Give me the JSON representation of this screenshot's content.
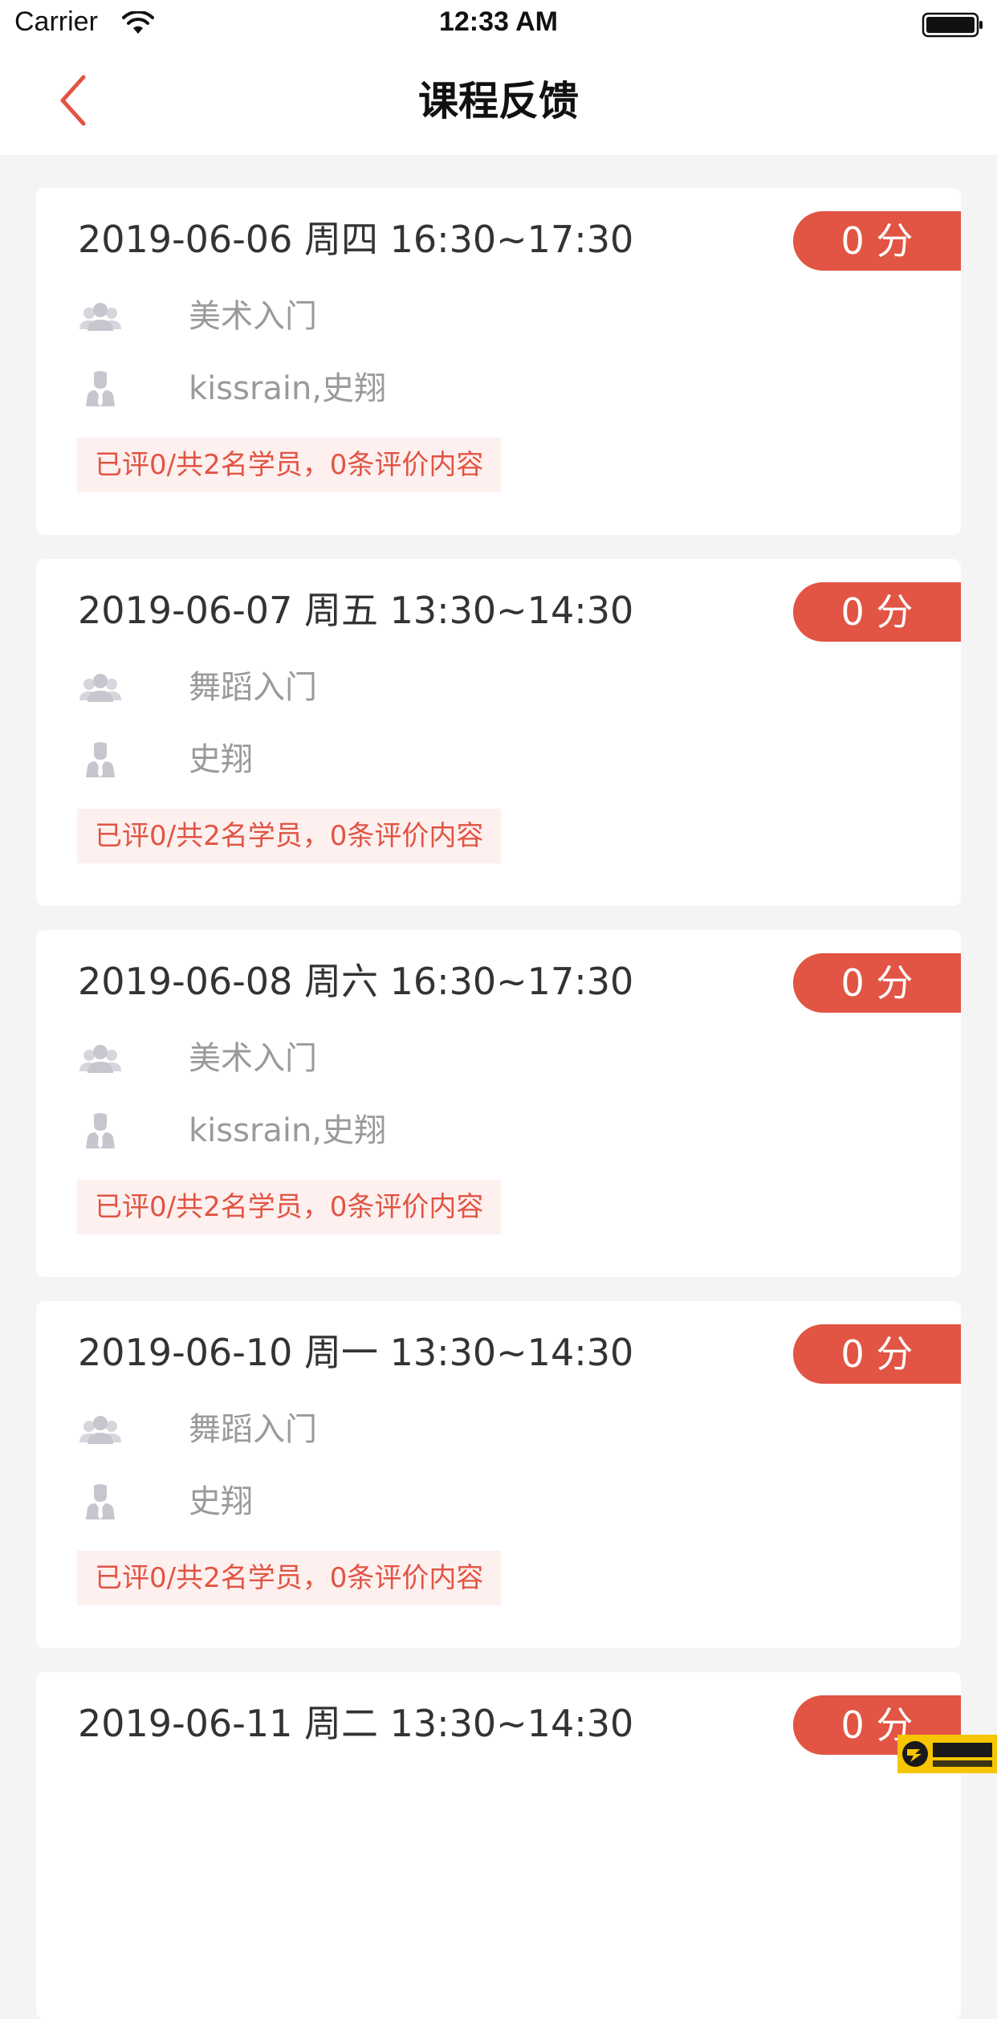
{
  "status_bar": {
    "carrier": "Carrier",
    "time": "12:33 AM"
  },
  "nav": {
    "title": "课程反馈"
  },
  "colors": {
    "accent": "#e25443",
    "background": "#f4f4f4",
    "card": "#ffffff",
    "summary_bg": "#fdf0ef",
    "secondary_text": "#9a9a9a"
  },
  "icons": {
    "back": "chevron-left-icon",
    "course": "group-icon",
    "teacher": "teacher-icon"
  },
  "lessons": [
    {
      "datetime": "2019-06-06 周四 16:30~17:30",
      "score": "0 分",
      "course": "美术入门",
      "teachers": "kissrain,史翔",
      "summary": "已评0/共2名学员，0条评价内容"
    },
    {
      "datetime": "2019-06-07 周五 13:30~14:30",
      "score": "0 分",
      "course": "舞蹈入门",
      "teachers": "史翔",
      "summary": "已评0/共2名学员，0条评价内容"
    },
    {
      "datetime": "2019-06-08 周六 16:30~17:30",
      "score": "0 分",
      "course": "美术入门",
      "teachers": "kissrain,史翔",
      "summary": "已评0/共2名学员，0条评价内容"
    },
    {
      "datetime": "2019-06-10 周一 13:30~14:30",
      "score": "0 分",
      "course": "舞蹈入门",
      "teachers": "史翔",
      "summary": "已评0/共2名学员，0条评价内容"
    },
    {
      "datetime": "2019-06-11 周二 13:30~14:30",
      "score": "0 分",
      "course": "",
      "teachers": "",
      "summary": ""
    }
  ],
  "watermark": {
    "name": "扬华下载",
    "url": "YANGHUA.NET"
  }
}
